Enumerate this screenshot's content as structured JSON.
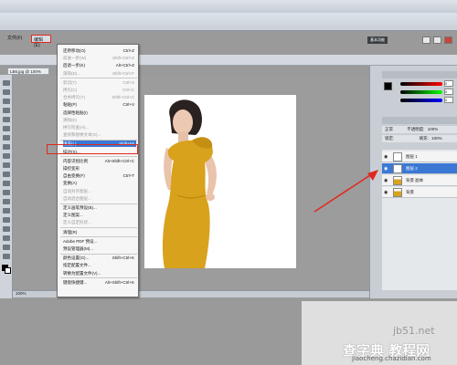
{
  "menubar": {
    "items": [
      "文件(F)",
      "编辑(E)"
    ],
    "basic_button": "基本功能"
  },
  "document": {
    "tab": "LB6.jpg @ 100%"
  },
  "status": {
    "zoom": "100%"
  },
  "edit_menu": {
    "items": [
      {
        "label": "还原移动(O)",
        "shortcut": "Ctrl+Z",
        "disabled": false
      },
      {
        "label": "前进一步(W)",
        "shortcut": "Shift+Ctrl+Z",
        "disabled": true
      },
      {
        "label": "后退一步(K)",
        "shortcut": "Alt+Ctrl+Z",
        "disabled": false
      },
      {
        "label": "渐隐(D)...",
        "shortcut": "Shift+Ctrl+F",
        "disabled": true
      },
      {
        "label": "剪切(T)",
        "shortcut": "Ctrl+X",
        "disabled": true
      },
      {
        "label": "拷贝(C)",
        "shortcut": "Ctrl+C",
        "disabled": true
      },
      {
        "label": "合并拷贝(Y)",
        "shortcut": "Shift+Ctrl+C",
        "disabled": true
      },
      {
        "label": "粘贴(P)",
        "shortcut": "Ctrl+V",
        "disabled": false
      },
      {
        "label": "选择性粘贴(I)",
        "shortcut": "",
        "disabled": false
      },
      {
        "label": "清除(E)",
        "shortcut": "",
        "disabled": true
      },
      {
        "label": "拼写检查(H)...",
        "shortcut": "",
        "disabled": true
      },
      {
        "label": "查找和替换文本(X)...",
        "shortcut": "",
        "disabled": true
      },
      {
        "label": "填充(L)...",
        "shortcut": "Shift+F5",
        "disabled": false,
        "selected": true
      },
      {
        "label": "描边(S)...",
        "shortcut": "",
        "disabled": false
      },
      {
        "label": "内容识别比例",
        "shortcut": "Alt+Shift+Ctrl+C",
        "disabled": false
      },
      {
        "label": "操控变形",
        "shortcut": "",
        "disabled": false
      },
      {
        "label": "自由变换(F)",
        "shortcut": "Ctrl+T",
        "disabled": false
      },
      {
        "label": "变换(A)",
        "shortcut": "",
        "disabled": false
      },
      {
        "label": "自动对齐图层...",
        "shortcut": "",
        "disabled": true
      },
      {
        "label": "自动混合图层...",
        "shortcut": "",
        "disabled": true
      },
      {
        "label": "定义画笔预设(B)...",
        "shortcut": "",
        "disabled": false
      },
      {
        "label": "定义图案...",
        "shortcut": "",
        "disabled": false
      },
      {
        "label": "定义自定形状...",
        "shortcut": "",
        "disabled": true
      },
      {
        "label": "清理(R)",
        "shortcut": "",
        "disabled": false
      },
      {
        "label": "Adobe PDF 预设...",
        "shortcut": "",
        "disabled": false
      },
      {
        "label": "预设管理器(M)...",
        "shortcut": "",
        "disabled": false
      },
      {
        "label": "颜色设置(G)...",
        "shortcut": "Shift+Ctrl+K",
        "disabled": false
      },
      {
        "label": "指定配置文件...",
        "shortcut": "",
        "disabled": false
      },
      {
        "label": "转换为配置文件(V)...",
        "shortcut": "",
        "disabled": false
      },
      {
        "label": "键盘快捷键...",
        "shortcut": "Alt+Shift+Ctrl+K",
        "disabled": false
      }
    ]
  },
  "color_panel": {
    "values": [
      "0",
      "0",
      "0"
    ]
  },
  "layers": {
    "blend_mode": "正常",
    "opacity_label": "不透明度:",
    "opacity_value": "100%",
    "lock_label": "锁定:",
    "fill_label": "填充:",
    "fill_value": "100%",
    "rows": [
      {
        "name": "图层 1",
        "active": false
      },
      {
        "name": "图层 2",
        "active": true
      },
      {
        "name": "背景 副本",
        "active": false
      },
      {
        "name": "背景",
        "active": false
      }
    ]
  },
  "watermark": {
    "line1": "jb51.net",
    "line2": "查字典 教程网",
    "line3": "jiaocheng.chazidian.com"
  },
  "colors": {
    "accent": "#3a78d4",
    "highlight_red": "#e0281f",
    "dress": "#d8a21c"
  }
}
